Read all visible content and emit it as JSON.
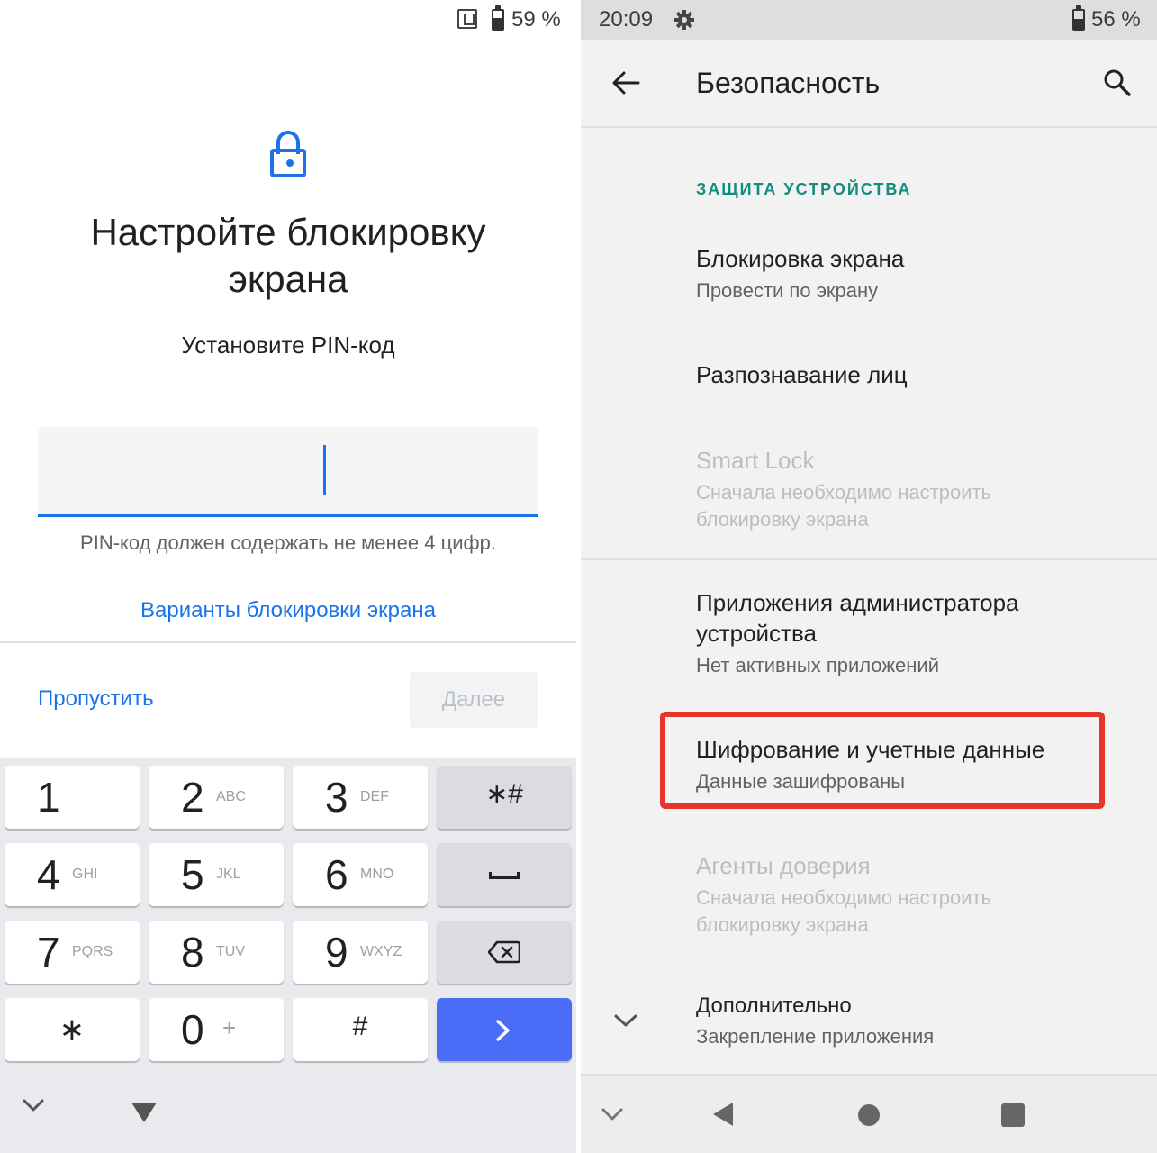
{
  "left_screen": {
    "status": {
      "battery_level": "59 %"
    },
    "title": "Настройте блокировку экрана",
    "subtitle": "Установите PIN-код",
    "pin_input": {
      "value": ""
    },
    "pin_hint": "PIN-код должен содержать не менее 4 цифр.",
    "lock_options_link": "Варианты блокировки экрана",
    "skip_button": "Пропустить",
    "next_button": "Далее",
    "keyboard": {
      "keys": [
        {
          "num": "1",
          "letters": ""
        },
        {
          "num": "2",
          "letters": "ABC"
        },
        {
          "num": "3",
          "letters": "DEF"
        },
        {
          "num": "4",
          "letters": "GHI"
        },
        {
          "num": "5",
          "letters": "JKL"
        },
        {
          "num": "6",
          "letters": "MNO"
        },
        {
          "num": "7",
          "letters": "PQRS"
        },
        {
          "num": "8",
          "letters": "TUV"
        },
        {
          "num": "9",
          "letters": "WXYZ"
        },
        {
          "num": "0",
          "letters": "+"
        }
      ],
      "star_hash": "∗#",
      "star": "∗",
      "hash": "#",
      "enter_color": "#4a6cf7"
    }
  },
  "right_screen": {
    "status": {
      "time": "20:09",
      "battery_level": "56 %"
    },
    "toolbar": {
      "title": "Безопасность"
    },
    "section_header": "ЗАЩИТА УСТРОЙСТВА",
    "items": [
      {
        "title": "Блокировка экрана",
        "subtitle": "Провести по экрану",
        "enabled": true
      },
      {
        "title": "Разпознавание лиц",
        "subtitle": "",
        "enabled": true
      },
      {
        "title": "Smart Lock",
        "subtitle": "Сначала необходимо настроить блокировку экрана",
        "enabled": false
      },
      {
        "title": "Приложения администратора устройства",
        "subtitle": "Нет активных приложений",
        "enabled": true
      },
      {
        "title": "Шифрование и учетные данные",
        "subtitle": "Данные зашифрованы",
        "enabled": true,
        "highlighted": true
      },
      {
        "title": "Агенты доверия",
        "subtitle": "Сначала необходимо настроить блокировку экрана",
        "enabled": false
      },
      {
        "title": "Дополнительно",
        "subtitle": "Закрепление приложения",
        "enabled": true
      }
    ],
    "highlight_color": "#e8352b",
    "accent_color": "#128c7e"
  },
  "brand_colors": {
    "primary_blue": "#1a73e8"
  }
}
